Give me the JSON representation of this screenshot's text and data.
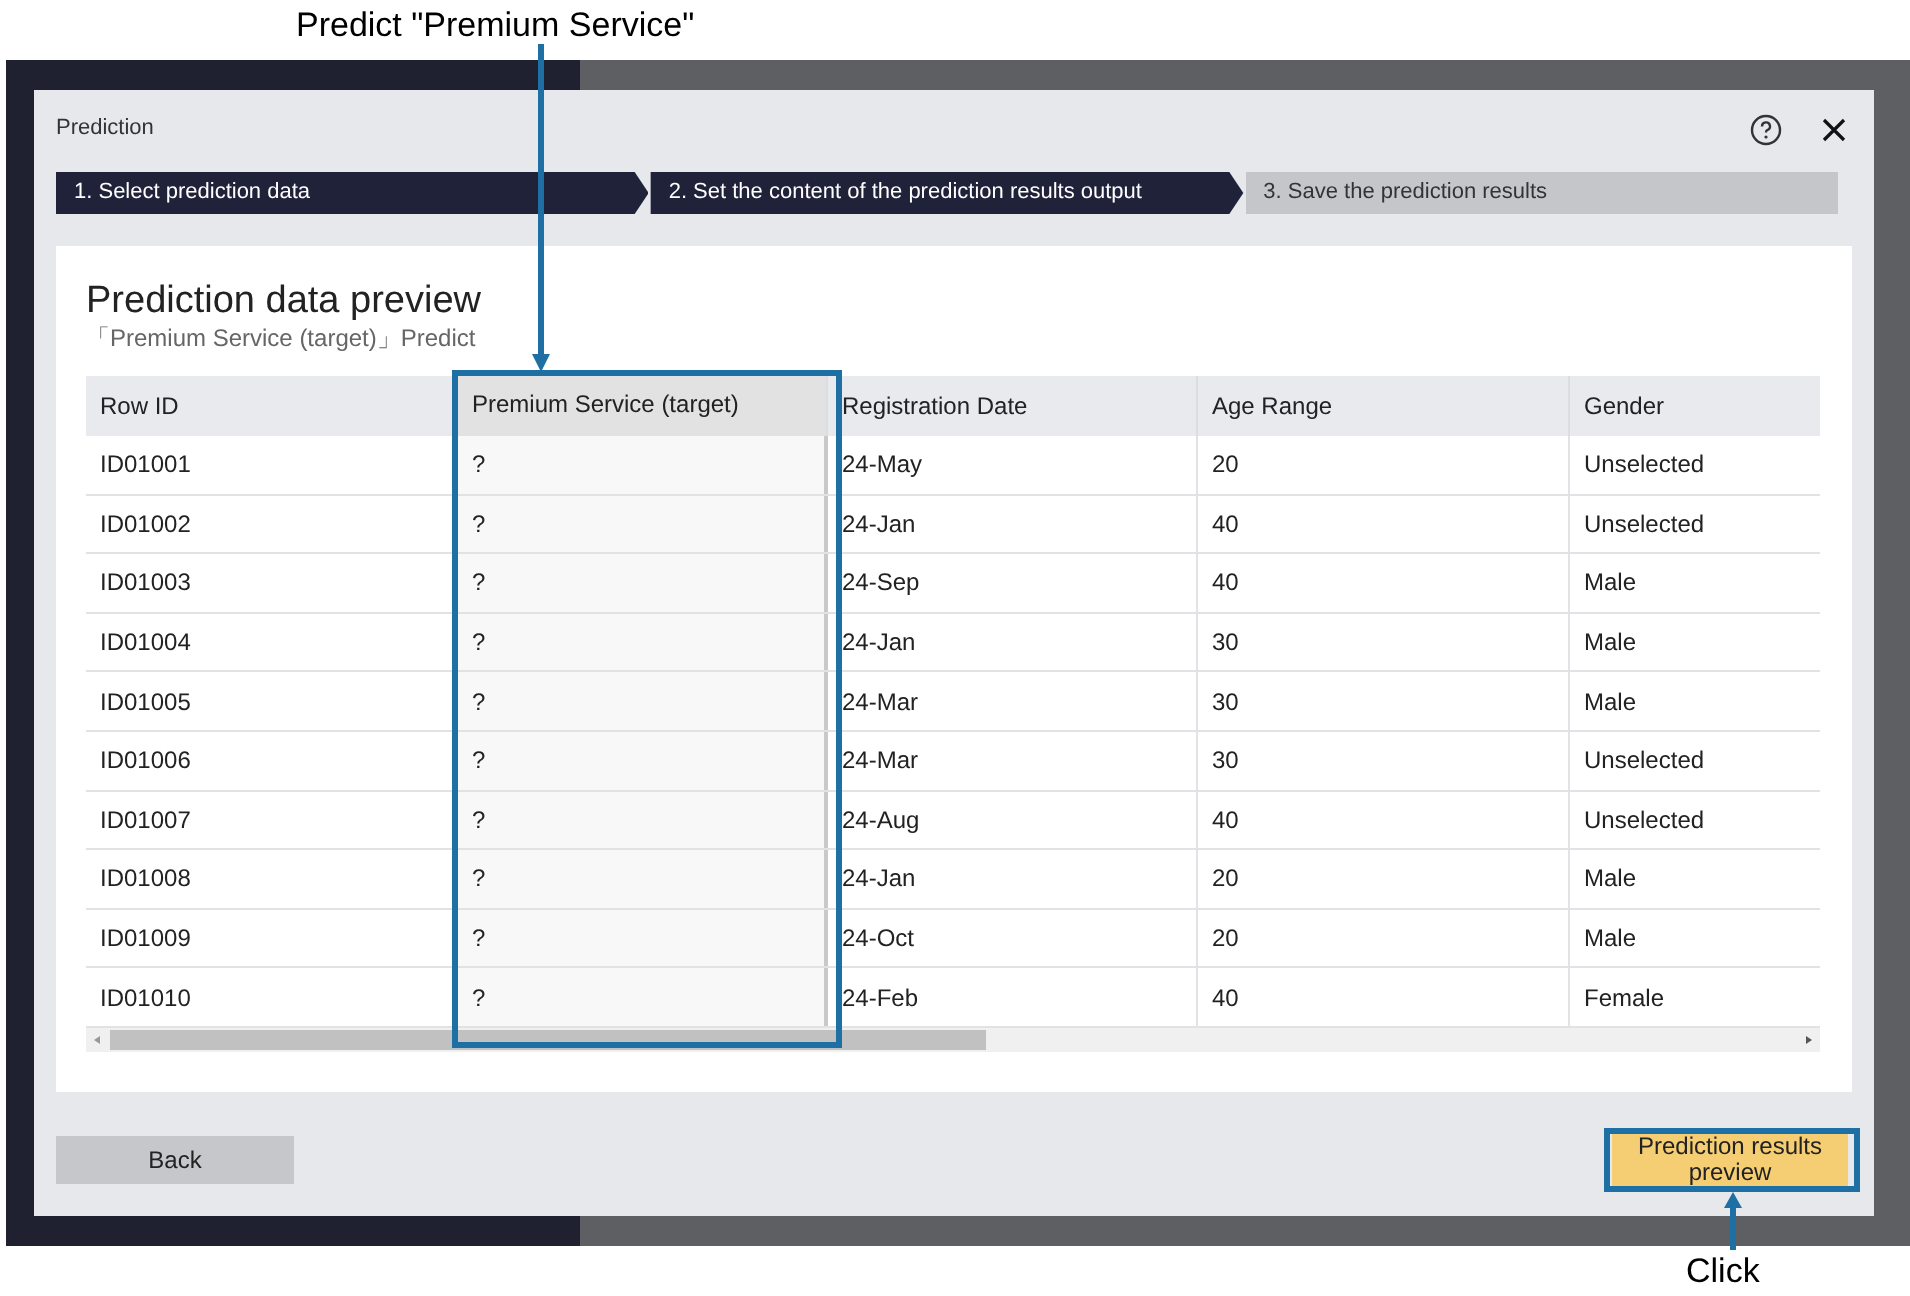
{
  "annotations": [
    {
      "kind": "top",
      "text": "Predict \"Premium Service\""
    },
    {
      "kind": "bottom",
      "text": "Click"
    }
  ],
  "dialog": {
    "title": "Prediction",
    "steps": [
      {
        "label": "1. Select prediction data",
        "active": true
      },
      {
        "label": "2. Set the content of the prediction results output",
        "active": true
      },
      {
        "label": "3. Save the prediction results",
        "active": false
      }
    ],
    "heading": "Prediction data preview",
    "subtitle": "「Premium Service (target)」Predict",
    "table": {
      "columns": [
        {
          "label": "Row ID",
          "kind": "feature"
        },
        {
          "label": "Premium Service (target)",
          "kind": "target"
        },
        {
          "label": "Registration Date",
          "kind": "feature"
        },
        {
          "label": "Age Range",
          "kind": "feature"
        },
        {
          "label": "Gender",
          "kind": "feature"
        }
      ],
      "rows": [
        [
          "ID01001",
          "?",
          "24-May",
          "20",
          "Unselected"
        ],
        [
          "ID01002",
          "?",
          "24-Jan",
          "40",
          "Unselected"
        ],
        [
          "ID01003",
          "?",
          "24-Sep",
          "40",
          "Male"
        ],
        [
          "ID01004",
          "?",
          "24-Jan",
          "30",
          "Male"
        ],
        [
          "ID01005",
          "?",
          "24-Mar",
          "30",
          "Male"
        ],
        [
          "ID01006",
          "?",
          "24-Mar",
          "30",
          "Unselected"
        ],
        [
          "ID01007",
          "?",
          "24-Aug",
          "40",
          "Unselected"
        ],
        [
          "ID01008",
          "?",
          "24-Jan",
          "20",
          "Male"
        ],
        [
          "ID01009",
          "?",
          "24-Oct",
          "20",
          "Male"
        ],
        [
          "ID01010",
          "?",
          "24-Feb",
          "40",
          "Female"
        ]
      ]
    },
    "buttons": {
      "back": "Back",
      "preview": "Prediction results preview"
    }
  }
}
